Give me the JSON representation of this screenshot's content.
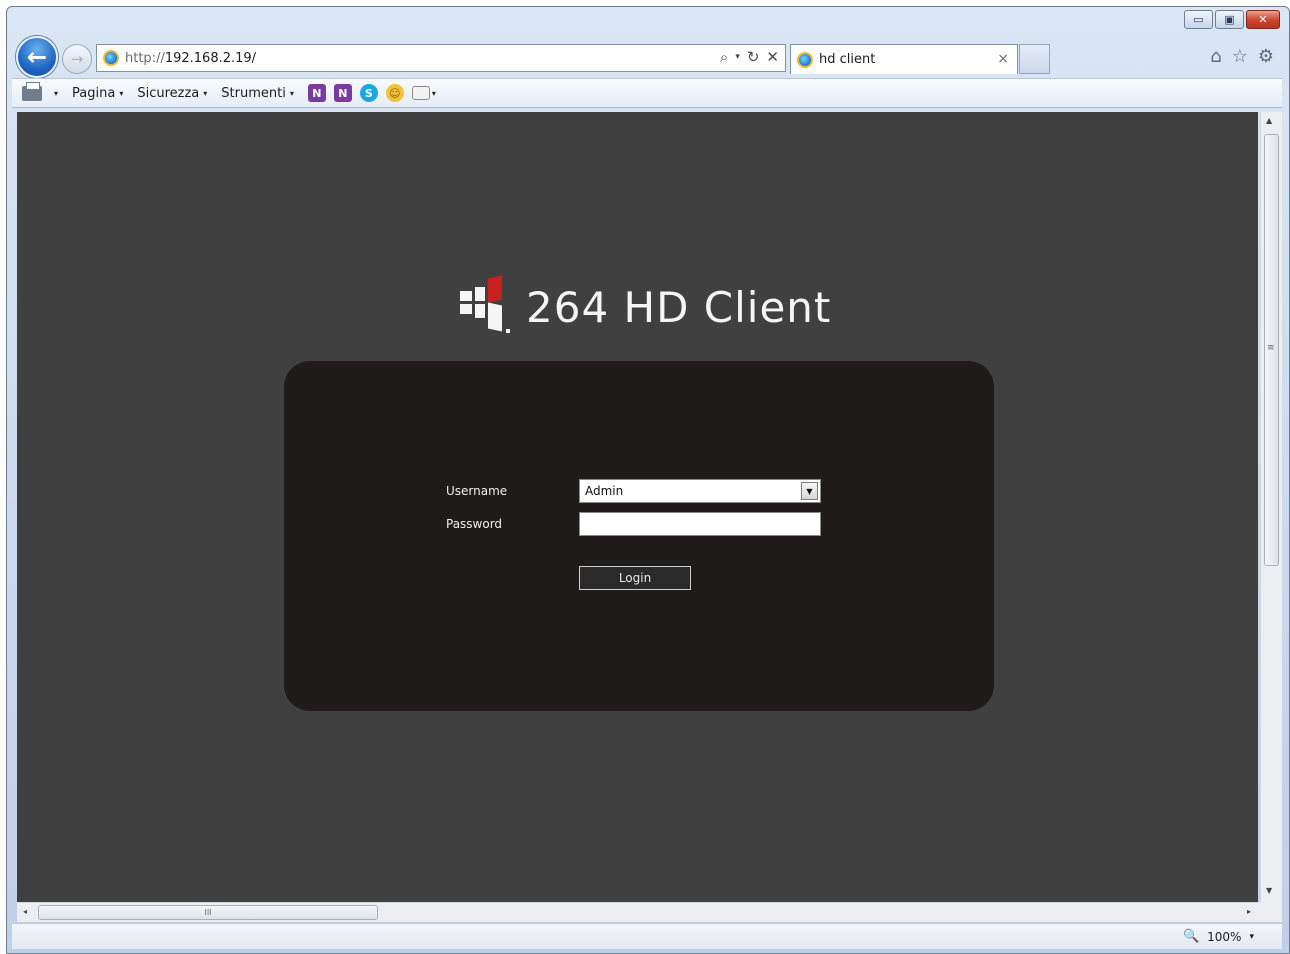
{
  "window": {
    "controls": {
      "minimize": "▭",
      "maximize": "▣",
      "close": "✕"
    }
  },
  "nav": {
    "back_icon": "back-arrow-icon",
    "forward_icon": "forward-arrow-icon",
    "address": {
      "protocol": "http://",
      "host": "192.168.2.19/"
    },
    "address_tools": {
      "search": "⌕",
      "dropdown": "▾",
      "refresh": "↻",
      "stop": "✕"
    }
  },
  "tab": {
    "title": "hd client",
    "close": "×"
  },
  "toolbar_right": {
    "home": "⌂",
    "favorites": "☆",
    "settings": "⚙"
  },
  "commandbar": {
    "print_dropdown": "▾",
    "menus": [
      {
        "label": "Pagina",
        "caret": "▾"
      },
      {
        "label": "Sicurezza",
        "caret": "▾"
      },
      {
        "label": "Strumenti",
        "caret": "▾"
      }
    ],
    "addon_icons": [
      {
        "name": "onenote-send-icon",
        "glyph": "N"
      },
      {
        "name": "onenote-linked-icon",
        "glyph": "N"
      },
      {
        "name": "skype-icon",
        "glyph": "S"
      },
      {
        "name": "smiley-icon",
        "glyph": "☺"
      }
    ],
    "layout_caret": "▾"
  },
  "page": {
    "brand_title": "264 HD Client",
    "login": {
      "username_label": "Username",
      "password_label": "Password",
      "username_value": "Admin",
      "password_value": "",
      "login_button": "Login",
      "select_arrow": "▼"
    }
  },
  "scrollbars": {
    "up": "▲",
    "down": "▼",
    "left": "◂",
    "right": "▸",
    "grip_v": "≡",
    "grip_h": "III"
  },
  "status": {
    "zoom": "100%",
    "zoom_caret": "▾",
    "zoom_icon": "🔍"
  },
  "colors": {
    "page_background": "#404040",
    "panel_background": "#1e1b1a",
    "logo_red": "#c8201f",
    "logo_white": "#f5f5f5"
  }
}
